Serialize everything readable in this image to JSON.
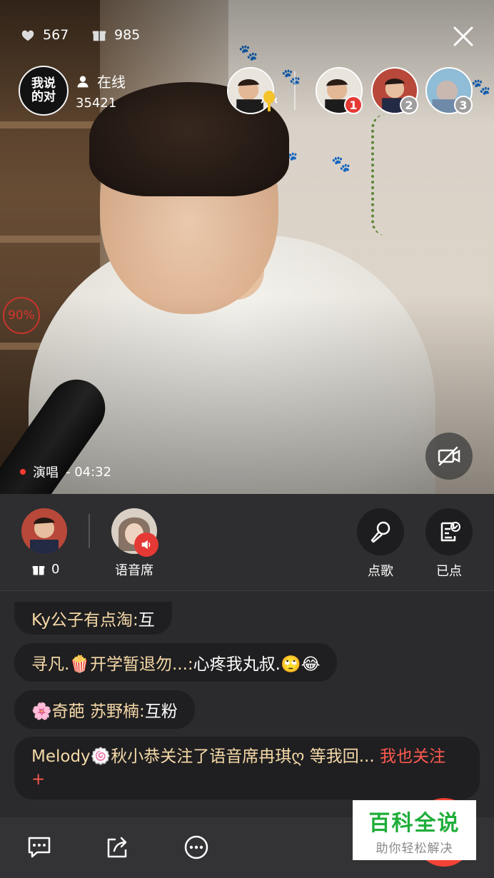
{
  "stats": {
    "likes": "567",
    "gifts": "985"
  },
  "host": {
    "logo_line1": "我说",
    "logo_line2": "的对",
    "online_label": "在线",
    "online_count": "35421"
  },
  "fans": [
    {
      "rank": "1",
      "rank_color": "#e53935"
    },
    {
      "rank": "2",
      "rank_color": "#9e9e9e"
    },
    {
      "rank": "3",
      "rank_color": "#9e9e9e"
    }
  ],
  "video": {
    "progress_label": "90%",
    "song_mode": "演唱",
    "song_time": "- 04:32"
  },
  "seatbar": {
    "host_gift_count": "0",
    "voice_seat_label": "语音席",
    "request_song_label": "点歌",
    "requested_label": "已点"
  },
  "chat": [
    {
      "name": "Ky公子有点淘:",
      "msg": " 互"
    },
    {
      "name": "寻凡.🍿开学暂退勿...:",
      "msg": " 心疼我丸叔.🙄😂"
    },
    {
      "name": "🌸奇葩 苏野楠:",
      "msg": " 互粉"
    },
    {
      "name": "Melody🍥秋小恭关注了语音席冉琪ღ",
      "msg": "等我回...",
      "action": "  我也关注 +"
    }
  ],
  "watermark": {
    "title": "百科全说",
    "subtitle": "助你轻松解决"
  },
  "colors": {
    "accent_red": "#f44336",
    "chat_name": "#f6d9a7",
    "watermark_green": "#1fae3a"
  },
  "icons": [
    "like-icon",
    "gift-icon",
    "user-icon",
    "close-icon",
    "microphone-icon",
    "camera-off-icon",
    "song-list-icon",
    "comment-icon",
    "share-icon",
    "more-icon",
    "speaker-icon"
  ]
}
